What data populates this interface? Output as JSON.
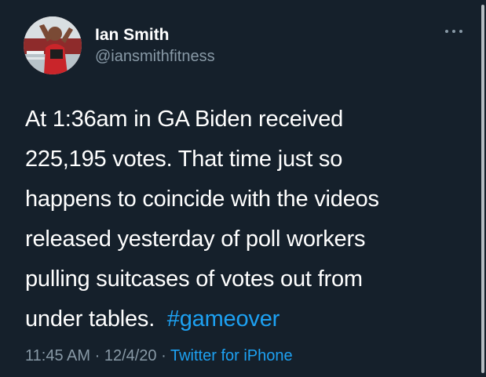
{
  "tweet": {
    "author": {
      "display_name": "Ian Smith",
      "handle": "@iansmithfitness"
    },
    "more_icon": "more-horizontal-icon",
    "text_lines": [
      "At 1:36am in GA Biden received",
      "225,195 votes. That time just so",
      "happens to coincide with the videos",
      "released yesterday of poll workers",
      "pulling suitcases of votes out from",
      "under tables. "
    ],
    "hashtag": "#gameover",
    "time": "11:45 AM",
    "separator": "·",
    "date": "12/4/20",
    "source": "Twitter for iPhone"
  },
  "colors": {
    "background": "#15202b",
    "text": "#ffffff",
    "secondary_text": "#8899a6",
    "link": "#1da1f2"
  }
}
